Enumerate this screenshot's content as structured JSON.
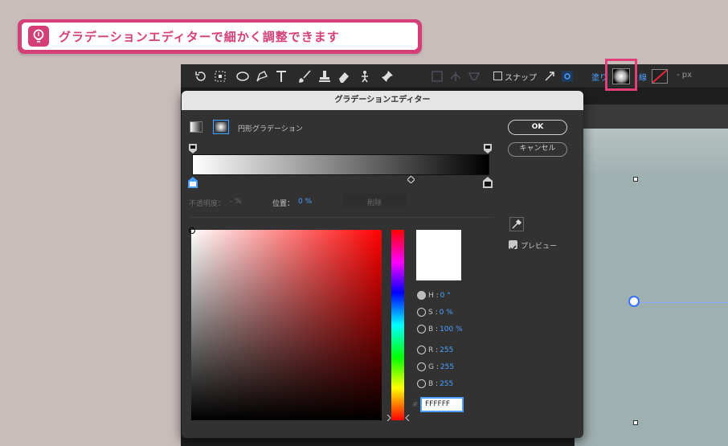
{
  "tip": {
    "text": "グラデーションエディターで細かく調整できます",
    "icon": "lightbulb-icon"
  },
  "toolbar": {
    "snap_label": "スナップ",
    "fill_label": "塗り",
    "stroke_label": "線",
    "unit_label": "- px"
  },
  "dialog": {
    "title": "グラデーションエディター",
    "gradient_type_label": "円形グラデーション",
    "ok_label": "OK",
    "cancel_label": "キャンセル",
    "opacity_label": "不透明度：",
    "opacity_value": "- %",
    "location_label": "位置：",
    "location_value": "0 %",
    "delete_label": "削除",
    "preview_label": "プレビュー",
    "hsb": {
      "h_label": "H :",
      "h_value": "0 °",
      "s_label": "S :",
      "s_value": "0 %",
      "b_label": "B :",
      "b_value": "100 %"
    },
    "rgb": {
      "r_label": "R :",
      "r_value": "255",
      "g_label": "G :",
      "g_value": "255",
      "b_label": "B :",
      "b_value": "255"
    },
    "hex_label": "#",
    "hex_value": "FFFFFF"
  },
  "colors": {
    "accent": "#d43f78",
    "blue": "#4aa0ff"
  }
}
